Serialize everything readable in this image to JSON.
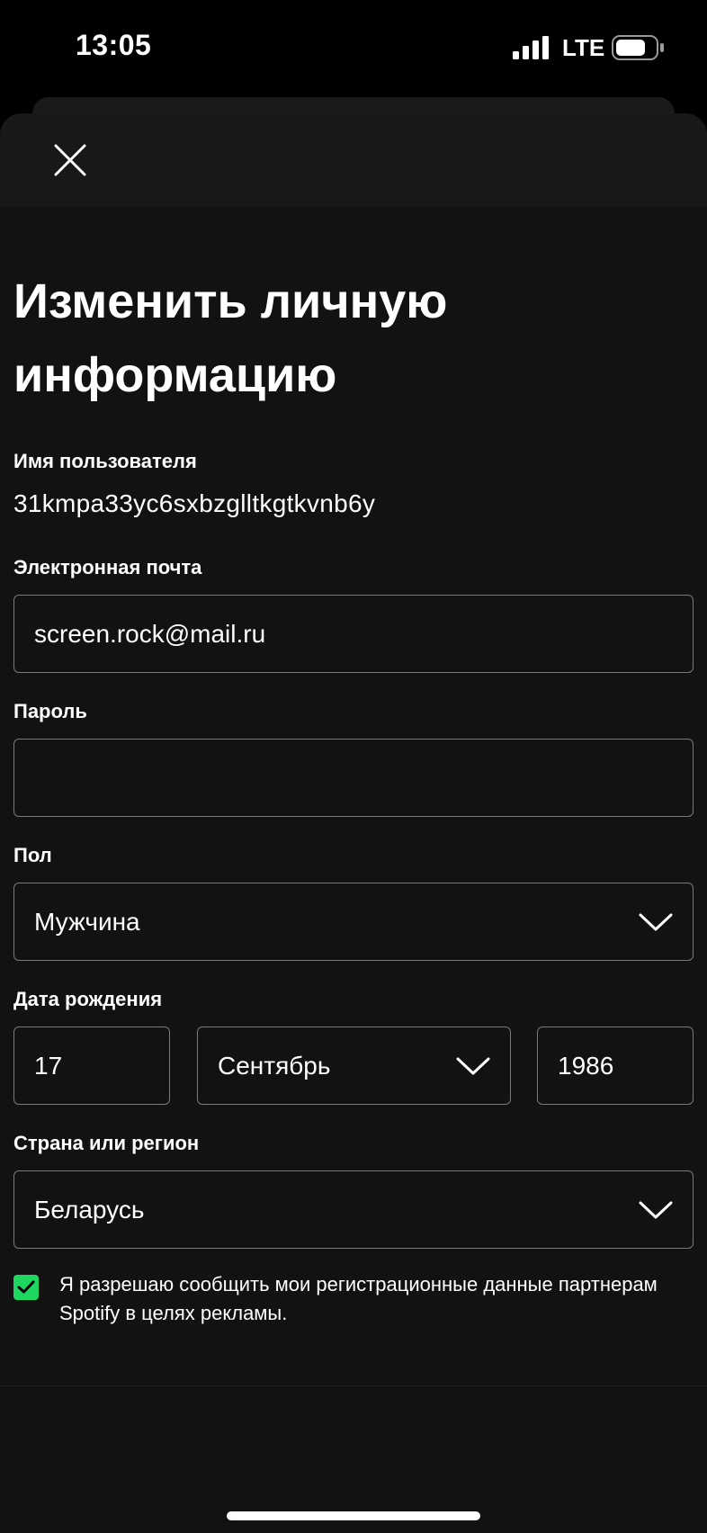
{
  "status_bar": {
    "time": "13:05",
    "network": "LTE",
    "icons": [
      "signal-icon",
      "battery-icon"
    ]
  },
  "header": {
    "close_icon": "close-icon"
  },
  "title": "Изменить личную информацию",
  "username": {
    "label": "Имя пользователя",
    "value": "31kmpa33yc6sxbzglltkgtkvnb6y"
  },
  "email": {
    "label": "Электронная почта",
    "value": "screen.rock@mail.ru"
  },
  "password": {
    "label": "Пароль",
    "value": ""
  },
  "gender": {
    "label": "Пол",
    "value": "Мужчина"
  },
  "birthdate": {
    "label": "Дата рождения",
    "day": "17",
    "month": "Сентябрь",
    "year": "1986"
  },
  "country": {
    "label": "Страна или регион",
    "value": "Беларусь"
  },
  "consent": {
    "checked": true,
    "text": "Я разрешаю сообщить мои регистрационные данные партнерам Spotify в целях рекламы."
  },
  "colors": {
    "background": "#121212",
    "header": "#181818",
    "accent": "#1ed760",
    "border": "#7a7a7a"
  }
}
